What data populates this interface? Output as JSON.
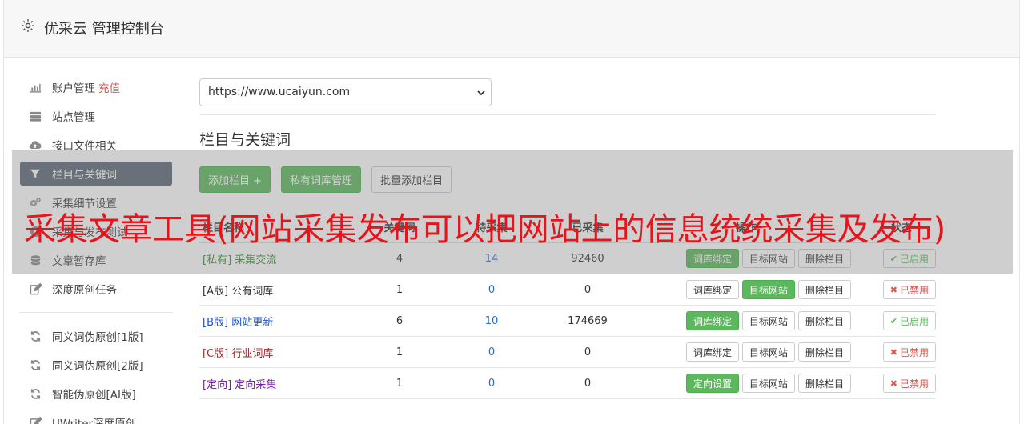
{
  "header": {
    "title": "优采云 管理控制台"
  },
  "sidebar": {
    "items": [
      {
        "label": "账户管理",
        "extra": "充值",
        "icon": "bar-chart-icon"
      },
      {
        "label": "站点管理",
        "icon": "server-icon"
      },
      {
        "label": "接口文件相关",
        "icon": "cloud-upload-icon"
      },
      {
        "label": "栏目与关键词",
        "icon": "filter-icon",
        "active": true
      },
      {
        "label": "采集细节设置",
        "icon": "gears-icon"
      },
      {
        "label": "采集与发布测试",
        "icon": "play-icon"
      },
      {
        "label": "文章暂存库",
        "icon": "database-icon"
      },
      {
        "label": "深度原创任务",
        "icon": "edit-icon"
      }
    ],
    "items2": [
      {
        "label": "同义词伪原创[1版]",
        "icon": "refresh-icon"
      },
      {
        "label": "同义词伪原创[2版]",
        "icon": "refresh-icon"
      },
      {
        "label": "智能伪原创[AI版]",
        "icon": "refresh-icon"
      },
      {
        "label": "UWriter深度原创",
        "icon": "edit-icon"
      }
    ]
  },
  "main": {
    "site_select": "https://www.ucaiyun.com",
    "section_title": "栏目与关键词",
    "buttons": {
      "add_column": "添加栏目 +",
      "private_lib": "私有词库管理",
      "batch_add": "批量添加栏目"
    },
    "table": {
      "headers": {
        "name": "栏目名称",
        "n1": "关键词",
        "n2": "待采集",
        "n3": "已采集",
        "ops": "操作",
        "status": "状态"
      },
      "ops_labels": {
        "bind": "词库绑定",
        "target": "目标网站",
        "delete": "删除栏目",
        "directed": "定向设置"
      },
      "rows": [
        {
          "tag": "[私有]",
          "name": "采集交流",
          "n1": "4",
          "n2": "14",
          "n3": "92460",
          "first_op": "词库绑定",
          "first_green": true,
          "target_green": false,
          "status": "已启用",
          "enabled": true,
          "color": "#3c8a3c"
        },
        {
          "tag": "[A版]",
          "name": "公有词库",
          "n1": "1",
          "n2": "0",
          "n3": "0",
          "first_op": "词库绑定",
          "first_green": false,
          "target_green": true,
          "status": "已禁用",
          "enabled": false,
          "color": "#333333"
        },
        {
          "tag": "[B版]",
          "name": "网站更新",
          "n1": "6",
          "n2": "10",
          "n3": "174669",
          "first_op": "词库绑定",
          "first_green": true,
          "target_green": false,
          "status": "已启用",
          "enabled": true,
          "color": "#1a4fd0"
        },
        {
          "tag": "[C版]",
          "name": "行业词库",
          "n1": "1",
          "n2": "0",
          "n3": "0",
          "first_op": "词库绑定",
          "first_green": false,
          "target_green": false,
          "status": "已禁用",
          "enabled": false,
          "color": "#a0282d"
        },
        {
          "tag": "[定向]",
          "name": "定向采集",
          "n1": "1",
          "n2": "0",
          "n3": "0",
          "first_op": "定向设置",
          "first_green": true,
          "target_green": false,
          "status": "已禁用",
          "enabled": false,
          "color": "#7a1fb0"
        }
      ]
    }
  },
  "overlay": {
    "text": "采集文章工具(网站采集发布可以把网站上的信息统统采集及发布)"
  }
}
